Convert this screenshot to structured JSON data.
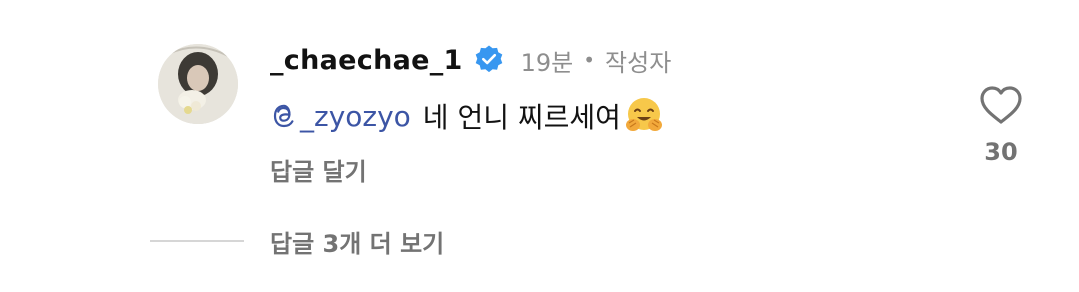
{
  "comment": {
    "username": "_chaechae_1",
    "verified": true,
    "time": "19분",
    "separator": "•",
    "author_label": "작성자",
    "mention": "_zyozyo",
    "text": "네 언니 찌르세여",
    "emoji": "smiling-face-with-open-hands",
    "reply_label": "답글 달기",
    "like_count": "30",
    "more_replies_label": "답글 3개 더 보기"
  },
  "colors": {
    "verified_badge": "#3897f0",
    "mention": "#3c55a5",
    "muted_text": "#737373",
    "meta_text": "#8e8e8e"
  }
}
